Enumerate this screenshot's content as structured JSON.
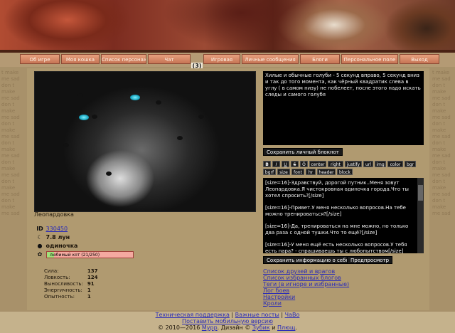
{
  "nav": {
    "items": [
      "Об игре",
      "Моя кошка",
      "Список персонажей",
      "Чат",
      "Игровая",
      "Личные сообщения",
      "Блоги",
      "Персональное поле",
      "Выход"
    ],
    "counter": "(3)"
  },
  "side_text": "t make me sad don t make me sad don t make me sad don t make me sad don t make me sad don t make me sad don t make me sad don t make me sad",
  "pet": {
    "name": "Леопардовка",
    "id": "330450",
    "age": "7.8 лун",
    "status": "одиночка",
    "badge": "любимый кот (21/250)",
    "badge_progress": 0.084
  },
  "attributes": [
    {
      "label": "Сила:",
      "value": "137"
    },
    {
      "label": "Ловкость:",
      "value": "124"
    },
    {
      "label": "Выносливость:",
      "value": "91"
    },
    {
      "label": "Энергичность:",
      "value": "1"
    },
    {
      "label": "Опытность:",
      "value": "1"
    }
  ],
  "notepad": {
    "text": "Хилые и обычные голуби - 5 секунд вправо, 5 секунд вниз и так до того момента, как чёрный квадратик слева в углу ( в самом низу) не побелеет, после этого надо искать следы и самого голубя",
    "save_label": "Сохранить личный блокнот"
  },
  "toolbar": [
    "B",
    "I",
    "U",
    "S",
    "Ö",
    "center",
    "right",
    "justify",
    "url",
    "img",
    "color",
    "bgr",
    "bgrf",
    "size",
    "font",
    "hr",
    "header",
    "block"
  ],
  "about": {
    "paragraphs": [
      "[size=16]-Здравствуй, дорогой путник..Меня зовут Леопардовка.Я чистокровная одиночка города.Что ты хотел спросить?[/size]",
      "[size=16]-Привет.У меня несколько вопросов.На тебе можно тренироваться?[/size]",
      "[size=16]-Да, тренироваться на мне можно, но только два раза с одной тушки.Что то ещё?[/size]",
      "[size=16]-У меня ещё есть несколько вопросов.У тебя есть пара? - спрашиваешь ты с любопытством[/size]"
    ],
    "save_label": "Сохранить информацию о себе",
    "preview_label": "Предпросмотр"
  },
  "menu_links": [
    "Список друзей и врагов",
    "Список избранных блогов",
    "Теги (в игноре и избранные)",
    "Лог боев",
    "Настройки",
    "Кроли"
  ],
  "footer": {
    "support": "Техническая поддержка",
    "sep": "|",
    "important": "Важные посты",
    "faq": "ЧаВо",
    "mobile": "Поставить мобильную версию",
    "copyright": "© 2010—2016",
    "site": "Мурр",
    "design_label": ". Дизайн ©",
    "author1": "Зубик",
    "and": "и",
    "author2": "Плющ",
    "dot": "."
  }
}
